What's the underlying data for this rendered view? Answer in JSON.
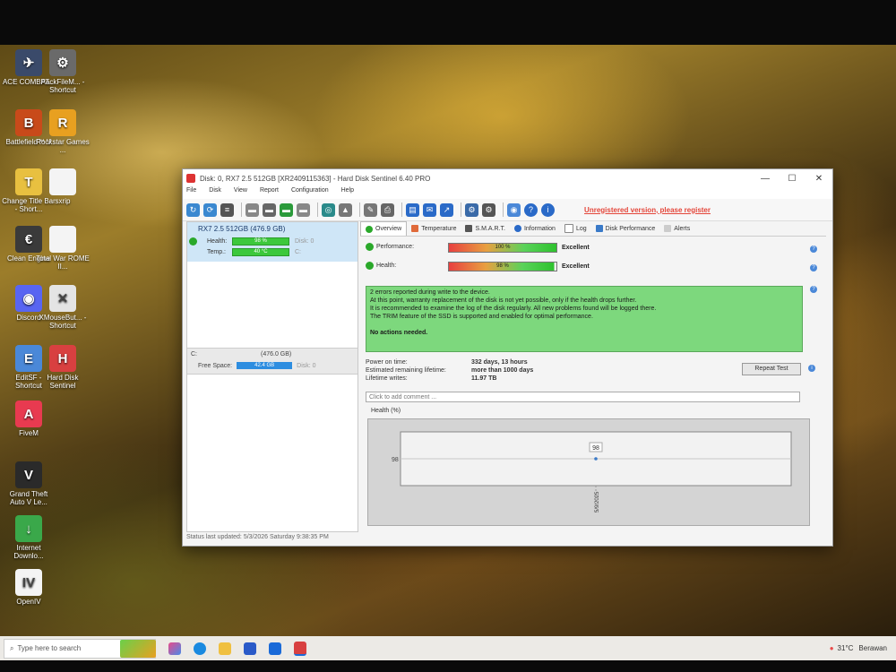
{
  "window": {
    "title": "Disk: 0, RX7 2.5 512GB [XR2409115363] - Hard Disk Sentinel 6.40 PRO",
    "menu": [
      "File",
      "Disk",
      "View",
      "Report",
      "Configuration",
      "Help"
    ],
    "unregistered": "Unregistered version, please register",
    "controls": {
      "minimize": "—",
      "maximize": "☐",
      "close": "✕"
    }
  },
  "left": {
    "disk_name": "RX7 2.5 512GB",
    "disk_size": "(476.9 GB)",
    "health_label": "Health:",
    "health_value": "98 %",
    "health_fraction": 0.98,
    "disk_tag": "Disk: 0",
    "temp_label": "Temp.:",
    "temp_value": "40 °C",
    "temp_tag": "C:",
    "volume_label": "C:",
    "volume_size": "(476.0 GB)",
    "free_label": "Free Space:",
    "free_value": "42.4 GB",
    "volume_disk": "Disk: 0"
  },
  "tabs": [
    {
      "label": "Overview",
      "icon": "check-icon"
    },
    {
      "label": "Temperature",
      "icon": "thermometer-icon"
    },
    {
      "label": "S.M.A.R.T.",
      "icon": "disk-icon"
    },
    {
      "label": "Information",
      "icon": "info-icon"
    },
    {
      "label": "Log",
      "icon": "log-icon"
    },
    {
      "label": "Disk Performance",
      "icon": "chart-icon"
    },
    {
      "label": "Alerts",
      "icon": "alert-icon"
    }
  ],
  "overview": {
    "performance_label": "Performance:",
    "performance_value": "100 %",
    "performance_fraction": 1.0,
    "performance_rating": "Excellent",
    "health_label": "Health:",
    "health_value": "98 %",
    "health_fraction": 0.98,
    "health_rating": "Excellent",
    "message_lines": [
      "2 errors reported during write to the device.",
      "At this point, warranty replacement of the disk is not yet possible, only if the health drops further.",
      "It is recommended to examine the log of the disk regularly. All new problems found will be logged there.",
      "The TRIM feature of the SSD is supported and enabled for optimal performance."
    ],
    "message_footer": "No actions needed.",
    "power_on_label": "Power on time:",
    "power_on_value": "332 days, 13 hours",
    "remaining_label": "Estimated remaining lifetime:",
    "remaining_value": "more than 1000 days",
    "writes_label": "Lifetime writes:",
    "writes_value": "11.97 TB",
    "repeat_button": "Repeat Test",
    "comment_placeholder": "Click to add comment ...",
    "chart_label": "Health (%)"
  },
  "chart_data": {
    "type": "line",
    "title": "Health (%)",
    "x": [
      "5/9/2025"
    ],
    "series": [
      {
        "values": [
          98
        ]
      }
    ],
    "ytick": "98"
  },
  "status_text": "Status last updated: 5/3/2026 Saturday 9:38:35 PM",
  "desktop_icons": [
    {
      "label": "ACE COMBAT...",
      "color": "#3a4a6a",
      "glyph": "✈"
    },
    {
      "label": "PackFileM... - Shortcut",
      "color": "#6a6a6a",
      "glyph": "⚙"
    },
    {
      "label": "Battlefield™ V",
      "color": "#c84a1a",
      "glyph": "B"
    },
    {
      "label": "Rockstar Games ...",
      "color": "#e8a020",
      "glyph": "R"
    },
    {
      "label": "Change Title Bar - Short...",
      "color": "#e8c040",
      "glyph": "T"
    },
    {
      "label": "sxrip",
      "color": "#f4f4f4",
      "glyph": ""
    },
    {
      "label": "Clean Engine",
      "color": "#3a3a3a",
      "glyph": "€"
    },
    {
      "label": "Total War ROME II...",
      "color": "#f4f4f4",
      "glyph": ""
    },
    {
      "label": "Discord",
      "color": "#5865f2",
      "glyph": "◉"
    },
    {
      "label": "XMouseBut... - Shortcut",
      "color": "#e4e4e4",
      "glyph": "✕"
    },
    {
      "label": "EditSF - Shortcut",
      "color": "#4a88d8",
      "glyph": "E"
    },
    {
      "label": "Hard Disk Sentinel",
      "color": "#d84040",
      "glyph": "H"
    },
    {
      "label": "FiveM",
      "color": "#e83a50",
      "glyph": "A"
    },
    {
      "label": "Grand Theft Auto V Le...",
      "color": "#2a2a2a",
      "glyph": "V"
    },
    {
      "label": "Internet Downlo...",
      "color": "#3aa84a",
      "glyph": "↓"
    },
    {
      "label": "OpenIV",
      "color": "#f4f4f4",
      "glyph": "IV"
    }
  ],
  "taskbar": {
    "search_placeholder": "Type here to search",
    "weather": "31°C",
    "weather_desc": "Berawan"
  }
}
